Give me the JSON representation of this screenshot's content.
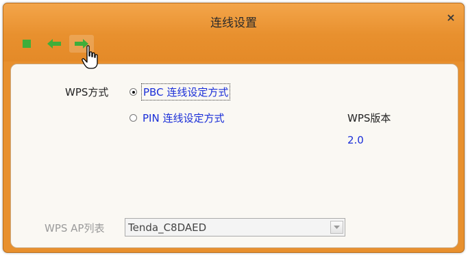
{
  "window": {
    "title": "连线设置",
    "close_glyph": "×"
  },
  "toolbar": {
    "buttons": [
      {
        "icon": "stop-square-icon",
        "color": "#3fae3a"
      },
      {
        "icon": "arrow-left-icon",
        "color": "#3fae3a"
      },
      {
        "icon": "arrow-right-icon",
        "color": "#3fae3a"
      }
    ]
  },
  "wps": {
    "method_label": "WPS方式",
    "options": [
      {
        "label": "PBC 连线设定方式",
        "checked": true
      },
      {
        "label": "PIN 连线设定方式",
        "checked": false
      }
    ],
    "version_label": "WPS版本",
    "version_value": "2.0",
    "ap_list_label": "WPS AP列表",
    "ap_list_selected": "Tenda_C8DAED"
  },
  "colors": {
    "titlebar": "#e8902e",
    "panel": "#faf8f3",
    "link_blue": "#1a2ed8",
    "icon_green": "#3fae3a"
  }
}
